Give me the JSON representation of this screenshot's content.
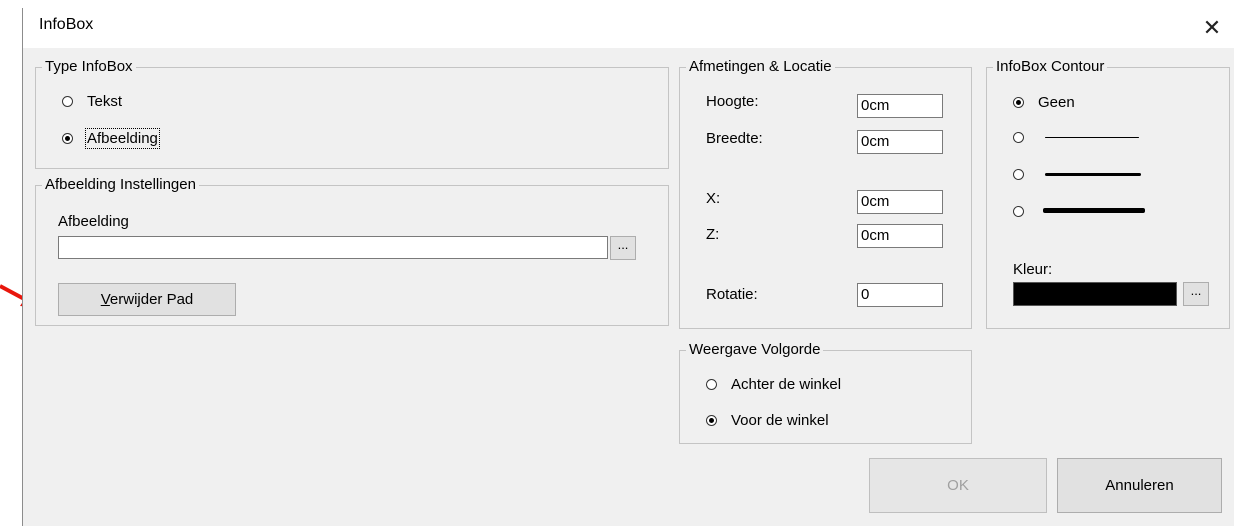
{
  "window": {
    "title": "InfoBox",
    "close_glyph": "✕"
  },
  "type_group": {
    "label": "Type InfoBox",
    "options": [
      {
        "label": "Tekst",
        "checked": false
      },
      {
        "label": "Afbeelding",
        "checked": true
      }
    ]
  },
  "image_group": {
    "label": "Afbeelding Instellingen",
    "field_label": "Afbeelding",
    "path_value": "",
    "browse_label": "...",
    "remove_label_prefix": "V",
    "remove_label_rest": "erwijder Pad"
  },
  "dimensions_group": {
    "label": "Afmetingen & Locatie",
    "height_label": "Hoogte:",
    "height_value": "0cm",
    "width_label": "Breedte:",
    "width_value": "0cm",
    "x_label": "X:",
    "x_value": "0cm",
    "z_label": "Z:",
    "z_value": "0cm",
    "rotation_label": "Rotatie:",
    "rotation_value": "0"
  },
  "contour_group": {
    "label": "InfoBox Contour",
    "options": [
      {
        "label": "Geen",
        "checked": true
      },
      {
        "line": "thin",
        "checked": false
      },
      {
        "line": "medium",
        "checked": false
      },
      {
        "line": "thick",
        "checked": false
      }
    ],
    "color_label": "Kleur:",
    "color_value": "#000000",
    "color_button_label": "..."
  },
  "order_group": {
    "label": "Weergave Volgorde",
    "options": [
      {
        "label": "Achter de winkel",
        "checked": false
      },
      {
        "label": "Voor de winkel",
        "checked": true
      }
    ]
  },
  "buttons": {
    "ok_label": "OK",
    "ok_enabled": false,
    "cancel_label": "Annuleren"
  },
  "annotation": {
    "arrow_color": "#e8160c"
  }
}
